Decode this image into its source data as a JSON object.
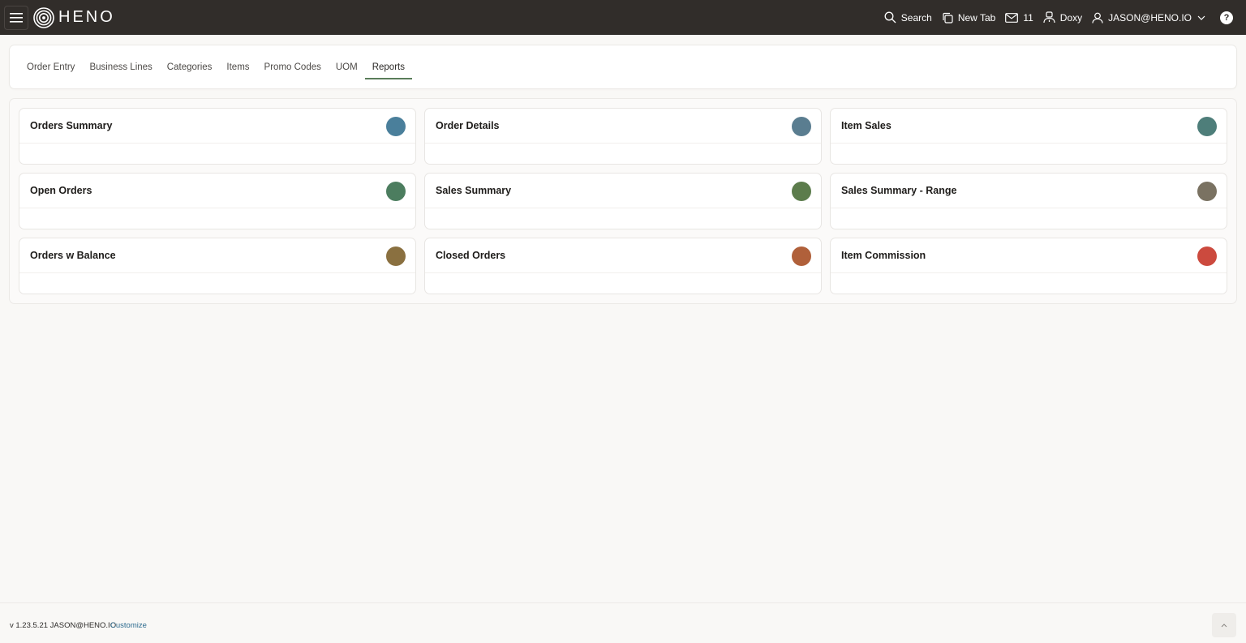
{
  "header": {
    "brand": "HENO",
    "search_label": "Search",
    "new_tab_label": "New Tab",
    "mail_count": "11",
    "doxy_label": "Doxy",
    "user_label": "JASON@HENO.IO",
    "help_label": "?"
  },
  "tabs": [
    {
      "label": "Order Entry",
      "active": false
    },
    {
      "label": "Business Lines",
      "active": false
    },
    {
      "label": "Categories",
      "active": false
    },
    {
      "label": "Items",
      "active": false
    },
    {
      "label": "Promo Codes",
      "active": false
    },
    {
      "label": "UOM",
      "active": false
    },
    {
      "label": "Reports",
      "active": true
    }
  ],
  "cards": [
    {
      "title": "Orders Summary",
      "color": "#4a7f9b"
    },
    {
      "title": "Order Details",
      "color": "#5a7d90"
    },
    {
      "title": "Item Sales",
      "color": "#4e7e7a"
    },
    {
      "title": "Open Orders",
      "color": "#4c7d5f"
    },
    {
      "title": "Sales Summary",
      "color": "#5c7c4c"
    },
    {
      "title": "Sales Summary - Range",
      "color": "#7a7262"
    },
    {
      "title": "Orders w Balance",
      "color": "#8a7040"
    },
    {
      "title": "Closed Orders",
      "color": "#b0603a"
    },
    {
      "title": "Item Commission",
      "color": "#cc4a3e"
    }
  ],
  "footer": {
    "version_text": "v 1.23.5.21 JASON@HENO.IO",
    "customize_label": "Customize"
  }
}
